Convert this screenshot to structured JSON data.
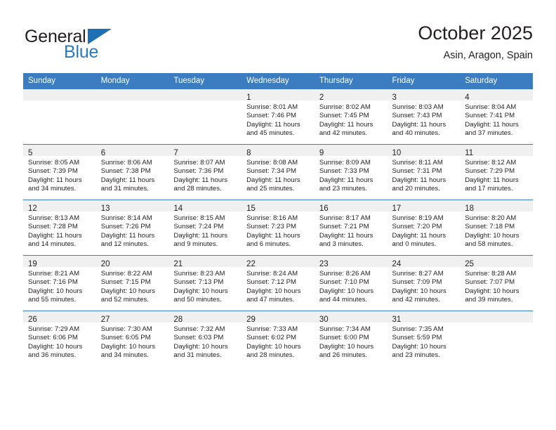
{
  "brand": {
    "name_part1": "General",
    "name_part2": "Blue",
    "flag_icon": "triangle-flag-icon"
  },
  "header": {
    "title": "October 2025",
    "subtitle": "Asin, Aragon, Spain"
  },
  "colors": {
    "header_blue": "#3b7dc0",
    "daynum_band": "#f0f0f0",
    "brand_blue": "#2a7ac0",
    "text": "#231f20"
  },
  "weekday_headers": [
    "Sunday",
    "Monday",
    "Tuesday",
    "Wednesday",
    "Thursday",
    "Friday",
    "Saturday"
  ],
  "weeks": [
    [
      {
        "day": "",
        "sunrise": "",
        "sunset": "",
        "daylight_line1": "",
        "daylight_line2": ""
      },
      {
        "day": "",
        "sunrise": "",
        "sunset": "",
        "daylight_line1": "",
        "daylight_line2": ""
      },
      {
        "day": "",
        "sunrise": "",
        "sunset": "",
        "daylight_line1": "",
        "daylight_line2": ""
      },
      {
        "day": "1",
        "sunrise": "Sunrise: 8:01 AM",
        "sunset": "Sunset: 7:46 PM",
        "daylight_line1": "Daylight: 11 hours",
        "daylight_line2": "and 45 minutes."
      },
      {
        "day": "2",
        "sunrise": "Sunrise: 8:02 AM",
        "sunset": "Sunset: 7:45 PM",
        "daylight_line1": "Daylight: 11 hours",
        "daylight_line2": "and 42 minutes."
      },
      {
        "day": "3",
        "sunrise": "Sunrise: 8:03 AM",
        "sunset": "Sunset: 7:43 PM",
        "daylight_line1": "Daylight: 11 hours",
        "daylight_line2": "and 40 minutes."
      },
      {
        "day": "4",
        "sunrise": "Sunrise: 8:04 AM",
        "sunset": "Sunset: 7:41 PM",
        "daylight_line1": "Daylight: 11 hours",
        "daylight_line2": "and 37 minutes."
      }
    ],
    [
      {
        "day": "5",
        "sunrise": "Sunrise: 8:05 AM",
        "sunset": "Sunset: 7:39 PM",
        "daylight_line1": "Daylight: 11 hours",
        "daylight_line2": "and 34 minutes."
      },
      {
        "day": "6",
        "sunrise": "Sunrise: 8:06 AM",
        "sunset": "Sunset: 7:38 PM",
        "daylight_line1": "Daylight: 11 hours",
        "daylight_line2": "and 31 minutes."
      },
      {
        "day": "7",
        "sunrise": "Sunrise: 8:07 AM",
        "sunset": "Sunset: 7:36 PM",
        "daylight_line1": "Daylight: 11 hours",
        "daylight_line2": "and 28 minutes."
      },
      {
        "day": "8",
        "sunrise": "Sunrise: 8:08 AM",
        "sunset": "Sunset: 7:34 PM",
        "daylight_line1": "Daylight: 11 hours",
        "daylight_line2": "and 25 minutes."
      },
      {
        "day": "9",
        "sunrise": "Sunrise: 8:09 AM",
        "sunset": "Sunset: 7:33 PM",
        "daylight_line1": "Daylight: 11 hours",
        "daylight_line2": "and 23 minutes."
      },
      {
        "day": "10",
        "sunrise": "Sunrise: 8:11 AM",
        "sunset": "Sunset: 7:31 PM",
        "daylight_line1": "Daylight: 11 hours",
        "daylight_line2": "and 20 minutes."
      },
      {
        "day": "11",
        "sunrise": "Sunrise: 8:12 AM",
        "sunset": "Sunset: 7:29 PM",
        "daylight_line1": "Daylight: 11 hours",
        "daylight_line2": "and 17 minutes."
      }
    ],
    [
      {
        "day": "12",
        "sunrise": "Sunrise: 8:13 AM",
        "sunset": "Sunset: 7:28 PM",
        "daylight_line1": "Daylight: 11 hours",
        "daylight_line2": "and 14 minutes."
      },
      {
        "day": "13",
        "sunrise": "Sunrise: 8:14 AM",
        "sunset": "Sunset: 7:26 PM",
        "daylight_line1": "Daylight: 11 hours",
        "daylight_line2": "and 12 minutes."
      },
      {
        "day": "14",
        "sunrise": "Sunrise: 8:15 AM",
        "sunset": "Sunset: 7:24 PM",
        "daylight_line1": "Daylight: 11 hours",
        "daylight_line2": "and 9 minutes."
      },
      {
        "day": "15",
        "sunrise": "Sunrise: 8:16 AM",
        "sunset": "Sunset: 7:23 PM",
        "daylight_line1": "Daylight: 11 hours",
        "daylight_line2": "and 6 minutes."
      },
      {
        "day": "16",
        "sunrise": "Sunrise: 8:17 AM",
        "sunset": "Sunset: 7:21 PM",
        "daylight_line1": "Daylight: 11 hours",
        "daylight_line2": "and 3 minutes."
      },
      {
        "day": "17",
        "sunrise": "Sunrise: 8:19 AM",
        "sunset": "Sunset: 7:20 PM",
        "daylight_line1": "Daylight: 11 hours",
        "daylight_line2": "and 0 minutes."
      },
      {
        "day": "18",
        "sunrise": "Sunrise: 8:20 AM",
        "sunset": "Sunset: 7:18 PM",
        "daylight_line1": "Daylight: 10 hours",
        "daylight_line2": "and 58 minutes."
      }
    ],
    [
      {
        "day": "19",
        "sunrise": "Sunrise: 8:21 AM",
        "sunset": "Sunset: 7:16 PM",
        "daylight_line1": "Daylight: 10 hours",
        "daylight_line2": "and 55 minutes."
      },
      {
        "day": "20",
        "sunrise": "Sunrise: 8:22 AM",
        "sunset": "Sunset: 7:15 PM",
        "daylight_line1": "Daylight: 10 hours",
        "daylight_line2": "and 52 minutes."
      },
      {
        "day": "21",
        "sunrise": "Sunrise: 8:23 AM",
        "sunset": "Sunset: 7:13 PM",
        "daylight_line1": "Daylight: 10 hours",
        "daylight_line2": "and 50 minutes."
      },
      {
        "day": "22",
        "sunrise": "Sunrise: 8:24 AM",
        "sunset": "Sunset: 7:12 PM",
        "daylight_line1": "Daylight: 10 hours",
        "daylight_line2": "and 47 minutes."
      },
      {
        "day": "23",
        "sunrise": "Sunrise: 8:26 AM",
        "sunset": "Sunset: 7:10 PM",
        "daylight_line1": "Daylight: 10 hours",
        "daylight_line2": "and 44 minutes."
      },
      {
        "day": "24",
        "sunrise": "Sunrise: 8:27 AM",
        "sunset": "Sunset: 7:09 PM",
        "daylight_line1": "Daylight: 10 hours",
        "daylight_line2": "and 42 minutes."
      },
      {
        "day": "25",
        "sunrise": "Sunrise: 8:28 AM",
        "sunset": "Sunset: 7:07 PM",
        "daylight_line1": "Daylight: 10 hours",
        "daylight_line2": "and 39 minutes."
      }
    ],
    [
      {
        "day": "26",
        "sunrise": "Sunrise: 7:29 AM",
        "sunset": "Sunset: 6:06 PM",
        "daylight_line1": "Daylight: 10 hours",
        "daylight_line2": "and 36 minutes."
      },
      {
        "day": "27",
        "sunrise": "Sunrise: 7:30 AM",
        "sunset": "Sunset: 6:05 PM",
        "daylight_line1": "Daylight: 10 hours",
        "daylight_line2": "and 34 minutes."
      },
      {
        "day": "28",
        "sunrise": "Sunrise: 7:32 AM",
        "sunset": "Sunset: 6:03 PM",
        "daylight_line1": "Daylight: 10 hours",
        "daylight_line2": "and 31 minutes."
      },
      {
        "day": "29",
        "sunrise": "Sunrise: 7:33 AM",
        "sunset": "Sunset: 6:02 PM",
        "daylight_line1": "Daylight: 10 hours",
        "daylight_line2": "and 28 minutes."
      },
      {
        "day": "30",
        "sunrise": "Sunrise: 7:34 AM",
        "sunset": "Sunset: 6:00 PM",
        "daylight_line1": "Daylight: 10 hours",
        "daylight_line2": "and 26 minutes."
      },
      {
        "day": "31",
        "sunrise": "Sunrise: 7:35 AM",
        "sunset": "Sunset: 5:59 PM",
        "daylight_line1": "Daylight: 10 hours",
        "daylight_line2": "and 23 minutes."
      },
      {
        "day": "",
        "sunrise": "",
        "sunset": "",
        "daylight_line1": "",
        "daylight_line2": ""
      }
    ]
  ]
}
